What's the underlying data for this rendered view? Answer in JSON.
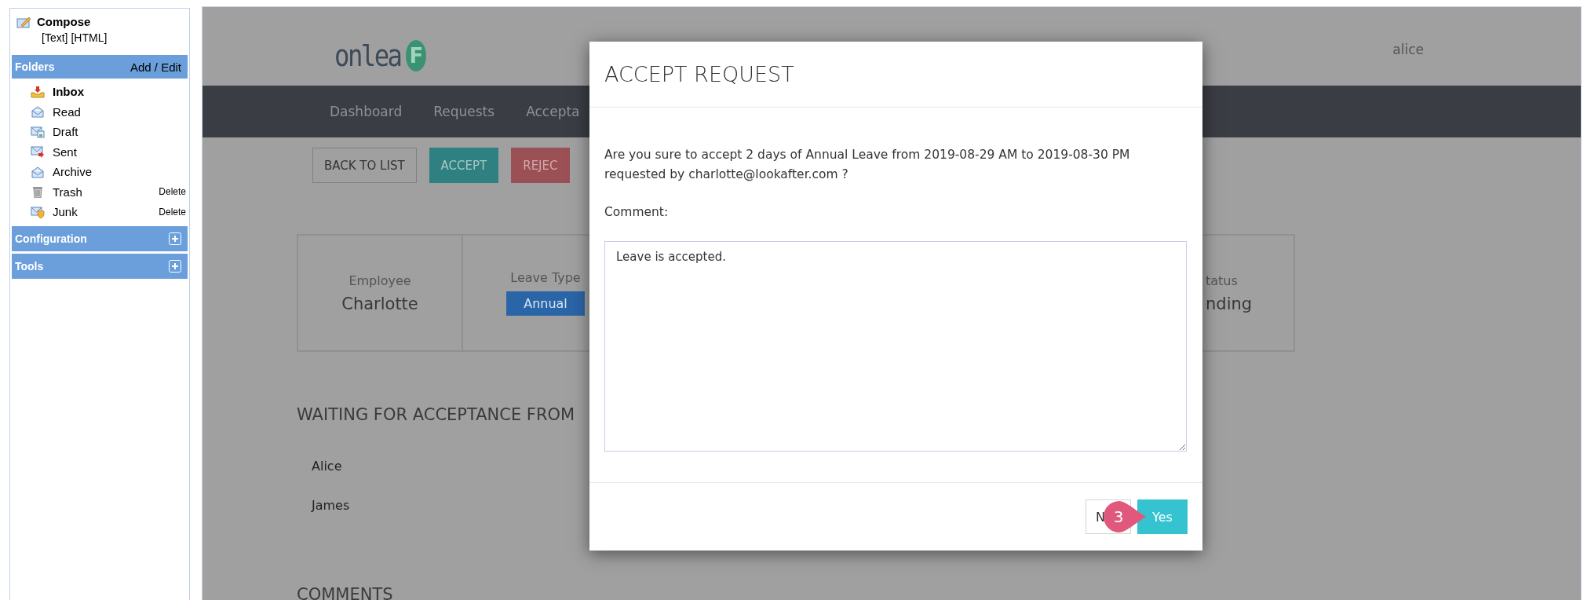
{
  "sidebar": {
    "compose": {
      "label": "Compose",
      "formats": [
        "[Text]",
        "[HTML]"
      ]
    },
    "folders": {
      "title": "Folders",
      "action": "Add / Edit",
      "items": [
        {
          "label": "Inbox",
          "selected": true
        },
        {
          "label": "Read",
          "selected": false
        },
        {
          "label": "Draft",
          "selected": false
        },
        {
          "label": "Sent",
          "selected": false
        },
        {
          "label": "Archive",
          "selected": false
        },
        {
          "label": "Trash",
          "selected": false,
          "action": "Delete"
        },
        {
          "label": "Junk",
          "selected": false,
          "action": "Delete"
        }
      ]
    },
    "sections": [
      {
        "title": "Configuration",
        "expanded": false
      },
      {
        "title": "Tools",
        "expanded": false
      }
    ]
  },
  "app": {
    "logo": {
      "text": "onlea",
      "mark": "F"
    },
    "user": "alice",
    "nav": [
      "Dashboard",
      "Requests",
      "Accepta"
    ],
    "actions": [
      {
        "label": "BACK TO LIST",
        "kind": "outline"
      },
      {
        "label": "ACCEPT",
        "kind": "accept"
      },
      {
        "label": "REJEC",
        "kind": "reject"
      }
    ],
    "cards": [
      {
        "label": "Employee",
        "value": "Charlotte",
        "kind": "text"
      },
      {
        "label": "Leave Type",
        "value": "Annual",
        "kind": "badge"
      },
      {
        "label": "tatus",
        "value": "nding",
        "kind": "text"
      }
    ],
    "waiting": {
      "title": "WAITING FOR ACCEPTANCE FROM",
      "people": [
        "Alice",
        "James"
      ]
    },
    "comments_title": "COMMENTS"
  },
  "modal": {
    "title": "ACCEPT REQUEST",
    "message": "Are you sure to accept 2 days of Annual Leave from 2019-08-29 AM to 2019-08-30 PM requested by charlotte@lookafter.com ?",
    "comment_label": "Comment:",
    "comment_value": "Leave is accepted.",
    "buttons": [
      {
        "label": "N",
        "kind": "secondary"
      },
      {
        "label": "Yes",
        "kind": "primary"
      }
    ],
    "step_badge": "3"
  }
}
